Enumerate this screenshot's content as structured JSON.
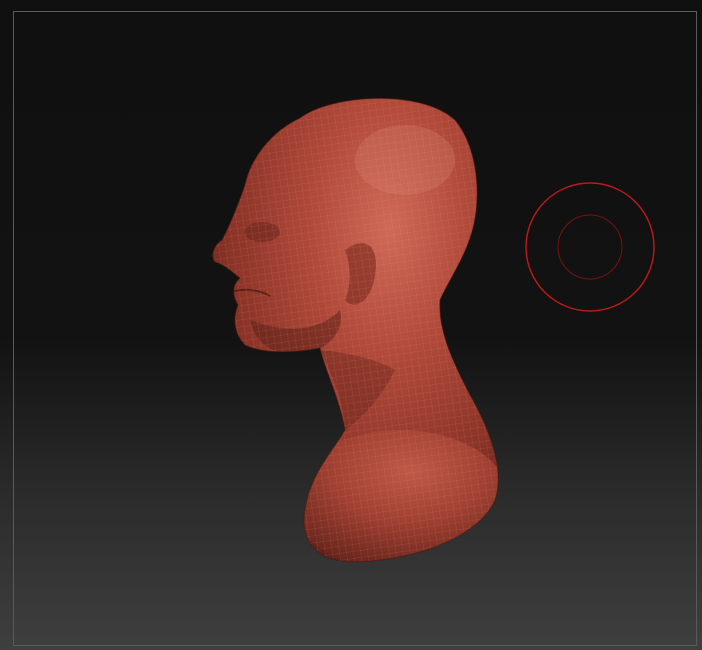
{
  "app": {
    "type": "3d-sculpting-viewport"
  },
  "canvas": {
    "background_top": "#101010",
    "background_bottom": "#3f3f3f",
    "frame_color": "#5a5a5a"
  },
  "model": {
    "subject": "head-bust",
    "material_color": "#b14a3b",
    "wireframe_visible": true
  },
  "brush": {
    "icon": "brush-cursor-icon",
    "color": "#c01818"
  }
}
